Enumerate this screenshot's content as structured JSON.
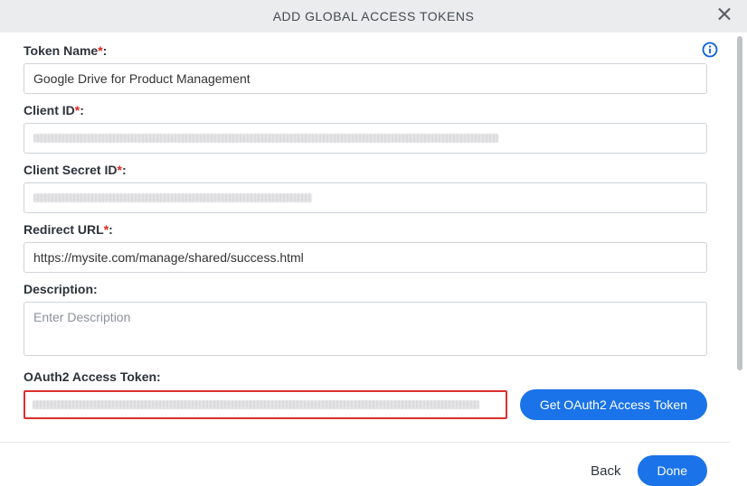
{
  "header": {
    "title": "ADD GLOBAL ACCESS TOKENS"
  },
  "fields": {
    "tokenName": {
      "label": "Token Name",
      "value": "Google Drive for Product Management"
    },
    "clientId": {
      "label": "Client ID",
      "value": "████████████████████████████████████████████████"
    },
    "clientSecret": {
      "label": "Client Secret ID",
      "value": "████████████████████████"
    },
    "redirectUrl": {
      "label": "Redirect URL",
      "value": "https://mysite.com/manage/shared/success.html"
    },
    "description": {
      "label": "Description:",
      "placeholder": "Enter Description",
      "value": ""
    },
    "oauthToken": {
      "label": "OAuth2 Access Token:",
      "value": "████████████████████████████████████████████████████████████████████"
    }
  },
  "buttons": {
    "getToken": "Get OAuth2 Access Token",
    "back": "Back",
    "done": "Done"
  },
  "colon": ":"
}
